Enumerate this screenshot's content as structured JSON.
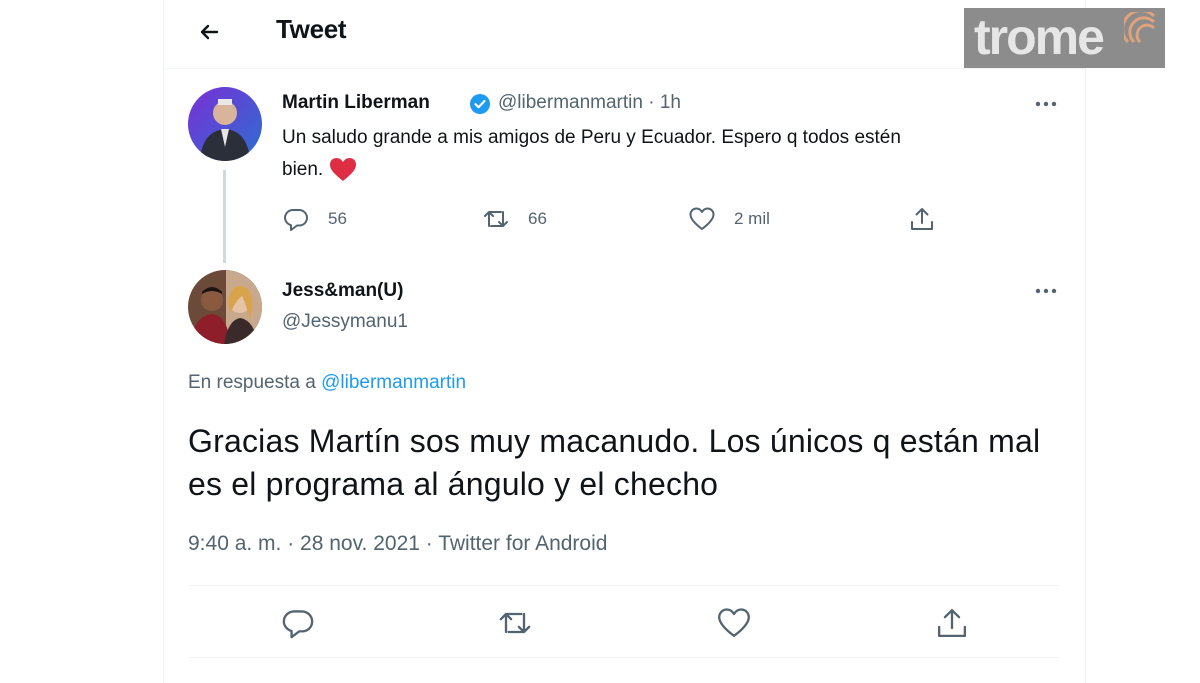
{
  "header": {
    "title": "Tweet",
    "back_icon": "arrow-left-icon"
  },
  "brand": {
    "logo_text": "trome"
  },
  "parent_tweet": {
    "author_name": "Martin Liberman",
    "handle_time": "@libermanmartin · 1h",
    "text_line1": "Un saludo grande a mis amigos de Peru y Ecuador. Espero q todos estén",
    "text_line2": "bien.",
    "emoji_icon": "red-heart-icon",
    "replies": "56",
    "retweets": "66",
    "likes": "2 mil"
  },
  "reply_tweet": {
    "author_name": "Jess&man(U)",
    "handle": "@Jessymanu1",
    "reply_to_prefix": "En respuesta a ",
    "reply_to_mention": "@libermanmartin",
    "text": "Gracias Martín sos muy macanudo. Los únicos q están mal es el programa al ángulo y el checho",
    "timestamp": "9:40 a. m. · 28 nov. 2021 · Twitter for Android"
  },
  "colors": {
    "accent": "#1d9bf0",
    "muted": "#536471",
    "heart": "#f91880",
    "logo_bg": "#8c8c8c"
  }
}
